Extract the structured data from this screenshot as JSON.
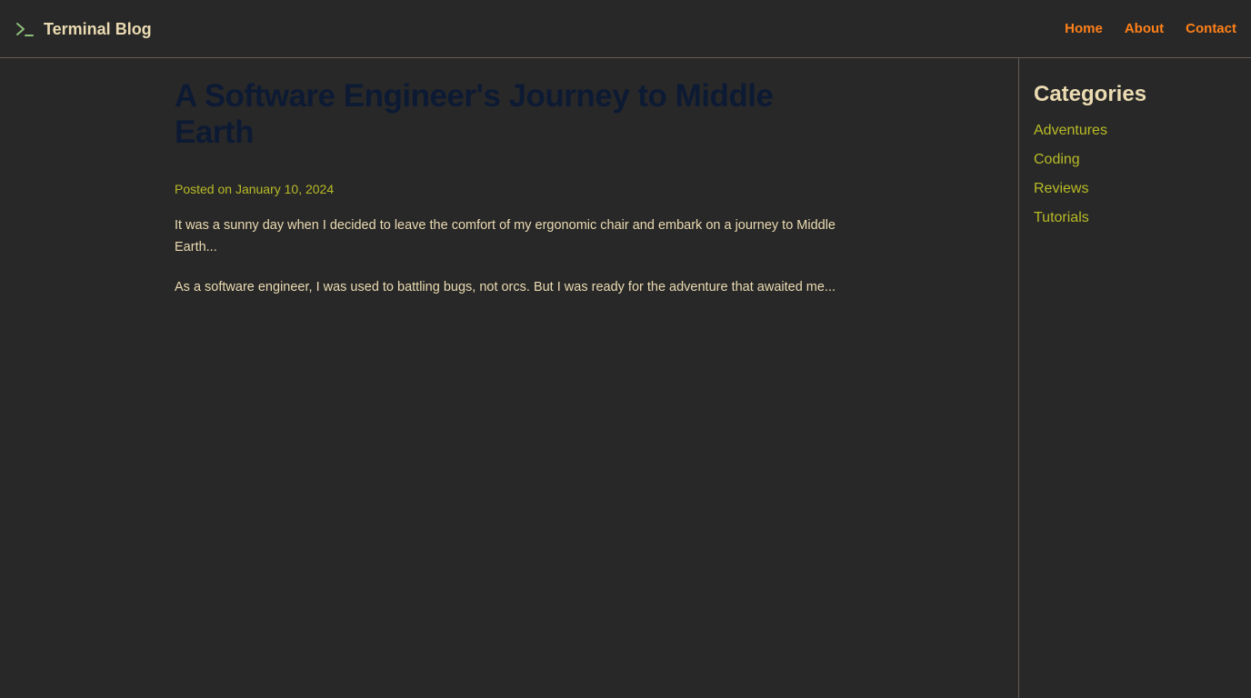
{
  "header": {
    "brand_icon": "terminal-prompt-icon",
    "brand_title": "Terminal Blog",
    "nav": [
      {
        "label": "Home"
      },
      {
        "label": "About"
      },
      {
        "label": "Contact"
      }
    ]
  },
  "post": {
    "title": "A Software Engineer's Journey to Middle Earth",
    "date": "Posted on January 10, 2024",
    "paragraphs": [
      "It was a sunny day when I decided to leave the comfort of my ergonomic chair and embark on a journey to Middle Earth...",
      "As a software engineer, I was used to battling bugs, not orcs. But I was ready for the adventure that awaited me..."
    ]
  },
  "sidebar": {
    "title": "Categories",
    "categories": [
      {
        "label": "Adventures"
      },
      {
        "label": "Coding"
      },
      {
        "label": "Reviews"
      },
      {
        "label": "Tutorials"
      }
    ]
  },
  "colors": {
    "background": "#282828",
    "text": "#ebdbb2",
    "accent_orange": "#fe8019",
    "accent_green": "#b8bb26",
    "title_navy": "#0d1a34",
    "border": "#665c54"
  }
}
